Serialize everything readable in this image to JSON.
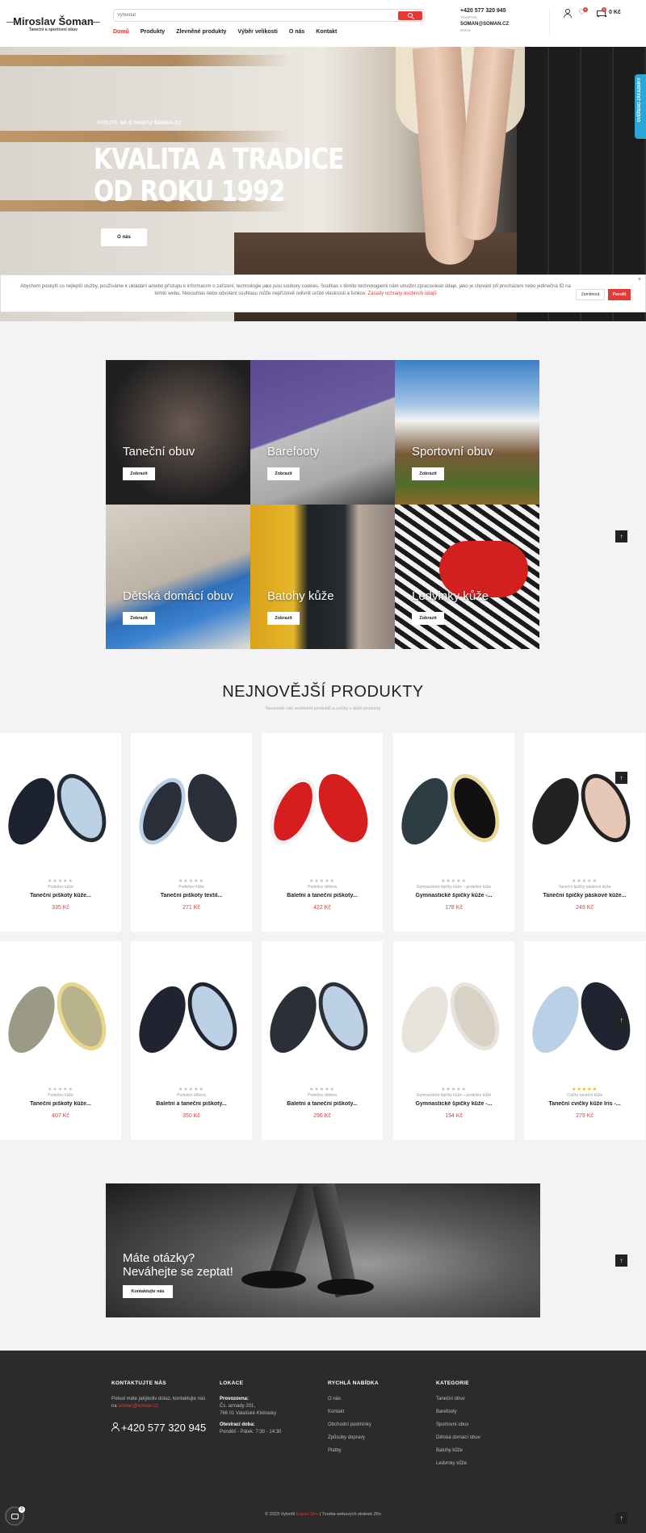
{
  "header": {
    "logo_name": "Miroslav Šoman",
    "logo_tagline": "Taneční a sportovní obuv",
    "search_placeholder": "Vyhledat",
    "nav": [
      "Domů",
      "Produkty",
      "Zlevněné produkty",
      "Výběr velikosti",
      "O nás",
      "Kontakt"
    ],
    "phone": "+420 577 320 945",
    "phone_label": "TELEFON",
    "email": "SOMAN@SOMAN.CZ",
    "email_label": "EMAIL",
    "wishlist_count": "0",
    "cart_count": "0",
    "cart_total": "0 Kč"
  },
  "hero": {
    "kicker": "VÍTEJTE NA E-SHOPU ŠOMAN.CZ",
    "title_line1": "KVALITA A TRADICE",
    "title_line2": "OD ROKU 1992",
    "button": "O nás",
    "verified_badge": "OVĚŘENO ZÁKAZNÍKY"
  },
  "cookie": {
    "text": "Abychom poskytli co nejlepší služby, používáme k ukládání a/nebo přístupu k informacím o zařízení, technologie jako jsou soubory cookies. Souhlas s těmito technologiemi nám umožní zpracovávat údaje, jako je chování při procházení nebo jedinečná ID na tomto webu. Nesouhlas nebo odvolání souhlasu může nepříznivě ovlivnit určité vlastnosti a funkce.",
    "link": "Zásady ochrany osobních údajů",
    "decline": "Zamítnout",
    "accept": "Povolit",
    "close": "×"
  },
  "categories": {
    "button": "Zobrazit",
    "items": [
      {
        "label": "Taneční obuv"
      },
      {
        "label": "Barefooty"
      },
      {
        "label": "Sportovní obuv"
      },
      {
        "label": "Dětská domácí obuv"
      },
      {
        "label": "Batohy kůže"
      },
      {
        "label": "Ledvinky kůže"
      }
    ]
  },
  "products_section": {
    "title": "NEJNOVĚJŠÍ PRODUKTY",
    "subtitle": "Nezávisle náš sortiment produktů a cvičky v další produkty"
  },
  "products": [
    {
      "category": "Podešev kůže",
      "name": "Taneční piškoty kůže...",
      "price": "335 Kč",
      "stars": "★★★★★",
      "rated": false
    },
    {
      "category": "Podešev kůže",
      "name": "Taneční piškoty textil...",
      "price": "271 Kč",
      "stars": "★★★★★",
      "rated": false
    },
    {
      "category": "Podešev dělená",
      "name": "Baletní a taneční piškoty...",
      "price": "422 Kč",
      "stars": "★★★★★",
      "rated": false
    },
    {
      "category": "Gymnastické špičky kůže – podešev kůže",
      "name": "Gymnastické špičky kůže -...",
      "price": "178 Kč",
      "stars": "★★★★★",
      "rated": false
    },
    {
      "category": "Taneční špičky páskové kůže",
      "name": "Taneční špičky páskové kůže...",
      "price": "249 Kč",
      "stars": "★★★★★",
      "rated": false
    },
    {
      "category": "Podešev kůže",
      "name": "Taneční piškoty kůže...",
      "price": "407 Kč",
      "stars": "★★★★★",
      "rated": false
    },
    {
      "category": "Podešev dělená",
      "name": "Baletní a taneční piškoty...",
      "price": "350 Kč",
      "stars": "★★★★★",
      "rated": false
    },
    {
      "category": "Podešev dělená",
      "name": "Baletní a taneční piškoty...",
      "price": "296 Kč",
      "stars": "★★★★★",
      "rated": false
    },
    {
      "category": "Gymnastické špičky kůže – podešev kůže",
      "name": "Gymnastické špičky kůže -...",
      "price": "194 Kč",
      "stars": "★★★★★",
      "rated": false
    },
    {
      "category": "Cvičky taneční kůže",
      "name": "Taneční cvičky kůže Iris -...",
      "price": "279 Kč",
      "stars": "★★★★★",
      "rated": true
    }
  ],
  "cta": {
    "line1": "Máte otázky?",
    "line2": "Neváhejte se zeptat!",
    "button": "Kontaktujte nás"
  },
  "footer": {
    "contact": {
      "heading": "KONTAKTUJTE NÁS",
      "text": "Pokud máte jakýkoliv dotaz, kontaktujte nás na",
      "email": "soman@soman.cz",
      "phone": "+420 577 320 945"
    },
    "location": {
      "heading": "LOKACE",
      "branch_label": "Provozovna:",
      "address1": "Čs. armády 201,",
      "address2": "766 01 Valašské Klobouky",
      "hours_label": "Otevírací doba:",
      "hours": "Pondělí - Pátek: 7:30 - 14:30"
    },
    "quick": {
      "heading": "RYCHLÁ NABÍDKA",
      "links": [
        "O nás",
        "Kontakt",
        "Obchodní podmínky",
        "Způsoby dopravy",
        "Platby"
      ]
    },
    "categories": {
      "heading": "KATEGORIE",
      "links": [
        "Taneční obuv",
        "Barefooty",
        "Sportovní obuv",
        "Dětská domácí obuv",
        "Batohy kůže",
        "Ledvinky kůže"
      ]
    },
    "copyright_pre": "© 2023 Vytvořil",
    "copyright_author": "Expert Dev",
    "copyright_post": "| Tvorba webových stránek Zlín"
  },
  "floating": {
    "to_top": "↑",
    "chat_badge": "0"
  }
}
